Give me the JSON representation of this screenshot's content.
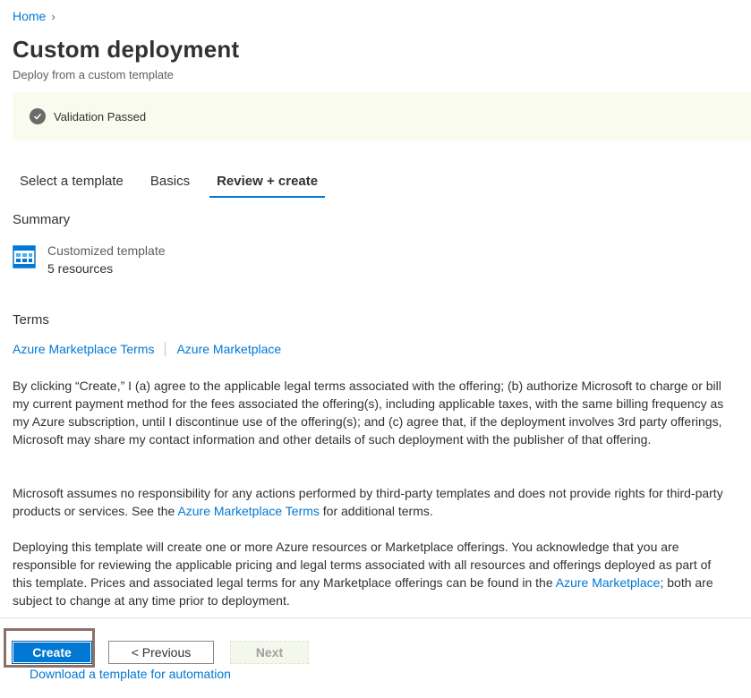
{
  "breadcrumb": {
    "home": "Home",
    "chevron": "›"
  },
  "header": {
    "title": "Custom deployment",
    "subtitle": "Deploy from a custom template"
  },
  "validation": {
    "status": "Validation Passed",
    "icon": "check-circle-icon"
  },
  "tabs": [
    {
      "label": "Select a template",
      "active": false
    },
    {
      "label": "Basics",
      "active": false
    },
    {
      "label": "Review + create",
      "active": true
    }
  ],
  "summary": {
    "heading": "Summary",
    "item_name": "Customized template",
    "item_count": "5 resources",
    "icon": "template-icon"
  },
  "terms": {
    "heading": "Terms",
    "link1": "Azure Marketplace Terms",
    "link2": "Azure Marketplace",
    "para1": "By clicking “Create,” I (a) agree to the applicable legal terms associated with the offering; (b) authorize Microsoft to charge or bill my current payment method for the fees associated the offering(s), including applicable taxes, with the same billing frequency as my Azure subscription, until I discontinue use of the offering(s); and (c) agree that, if the deployment involves 3rd party offerings, Microsoft may share my contact information and other details of such deployment with the publisher of that offering.",
    "para2_before": "Microsoft assumes no responsibility for any actions performed by third-party templates and does not provide rights for third-party products or services. See the ",
    "para2_link": "Azure Marketplace Terms",
    "para2_after": " for additional terms.",
    "para3_before": "Deploying this template will create one or more Azure resources or Marketplace offerings.  You acknowledge that you are responsible for reviewing the applicable pricing and legal terms associated with all resources and offerings deployed as part of this template.  Prices and associated legal terms for any Marketplace offerings can be found in the ",
    "para3_link": "Azure Marketplace",
    "para3_after": "; both are subject to change at any time prior to deployment."
  },
  "footer": {
    "create": "Create",
    "previous": "< Previous",
    "next": "Next",
    "automation": "Download a template for automation"
  },
  "colors": {
    "accent": "#0078d4",
    "banner_bg": "#f8fbee",
    "highlight_border": "#8c7168"
  }
}
